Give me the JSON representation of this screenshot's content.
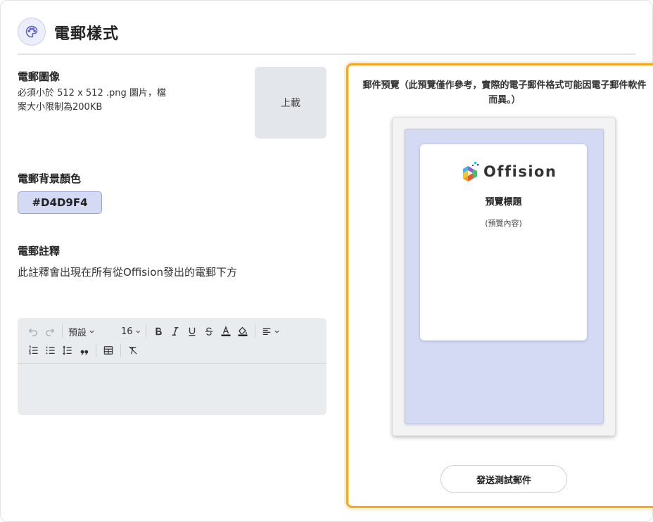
{
  "header": {
    "title": "電郵樣式",
    "icon": "palette-icon"
  },
  "email_image": {
    "title": "電郵圖像",
    "description_line1": "必須小於 512 x 512 .png 圖片，檔",
    "description_line2": "案大小限制為200KB",
    "upload_label": "上載"
  },
  "background_color": {
    "title": "電郵背景顏色",
    "value": "#D4D9F4"
  },
  "footer_note": {
    "title": "電郵註釋",
    "description": "此註釋會出現在所有從Offision發出的電郵下方"
  },
  "editor": {
    "font_family": "預設",
    "font_size": "16",
    "content": ""
  },
  "preview": {
    "caption": "郵件預覽（此預覽僅作參考，實際的電子郵件格式可能因電子郵件軟件而異。）",
    "logo_text": "Offision",
    "title": "預覽標題",
    "body": "(預覽內容)",
    "test_button": "發送測試郵件"
  },
  "colors": {
    "accent_orange": "#F5A623",
    "email_background": "#D4D9F4",
    "header_icon_bg": "#ECEEFB"
  }
}
